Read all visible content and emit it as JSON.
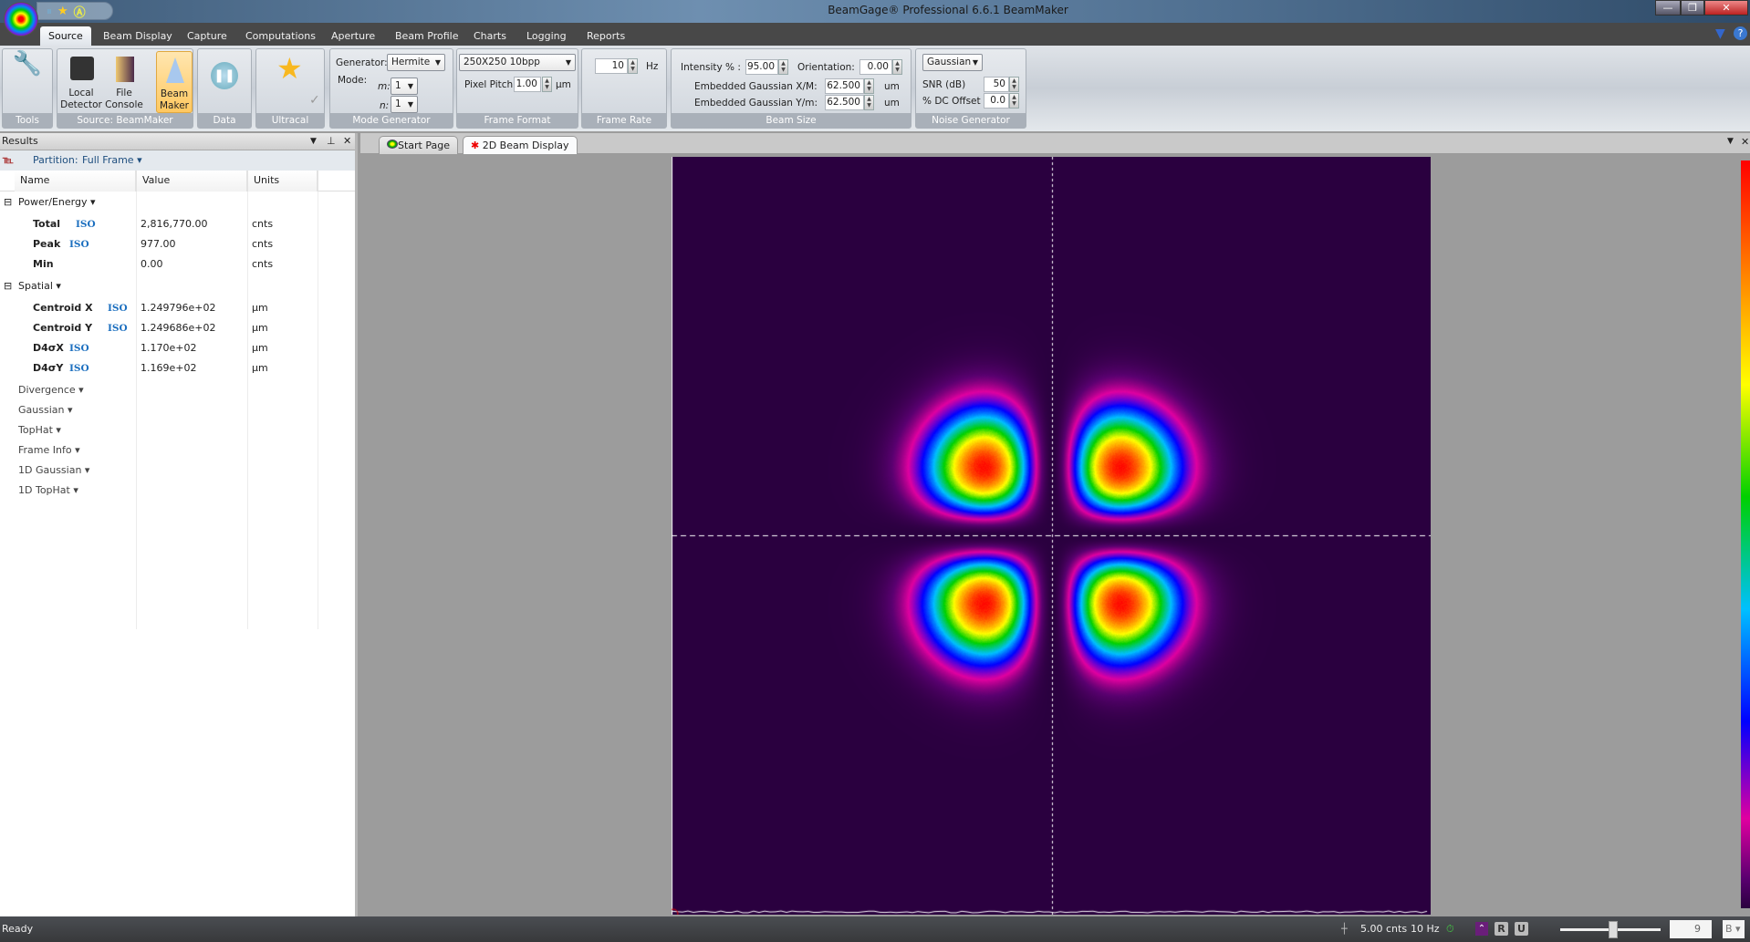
{
  "window": {
    "title": "BeamGage® Professional 6.6.1 BeamMaker"
  },
  "quick_access": [
    "pause-icon",
    "star-icon",
    "ultracal-icon"
  ],
  "menu": {
    "tabs": [
      "Source",
      "Beam Display",
      "Capture",
      "Computations",
      "Aperture",
      "Beam Profile",
      "Charts",
      "Logging",
      "Reports"
    ],
    "active": "Source"
  },
  "ribbon": {
    "tools": {
      "label": "Tools"
    },
    "source": {
      "label": "Source: BeamMaker",
      "local_detector": "Local Detector",
      "file_console": "File Console",
      "beam_maker": "Beam Maker"
    },
    "data": {
      "label": "Data"
    },
    "ultracal": {
      "label": "Ultracal"
    },
    "mode_generator": {
      "label": "Mode Generator",
      "generator_label": "Generator:",
      "generator": "Hermite",
      "mode_label": "Mode:",
      "m_label": "m:",
      "m": "1",
      "n_label": "n:",
      "n": "1"
    },
    "frame_format": {
      "label": "Frame Format",
      "format": "250X250 10bpp",
      "pixel_pitch_label": "Pixel Pitch:",
      "pixel_pitch": "1.00",
      "pixel_pitch_unit": "µm"
    },
    "frame_rate": {
      "label": "Frame Rate",
      "value": "10",
      "unit": "Hz"
    },
    "beam_size": {
      "label": "Beam Size",
      "intensity_label": "Intensity % :",
      "intensity": "95.00",
      "orientation_label": "Orientation:",
      "orientation": "0.00",
      "gx_label": "Embedded Gaussian X/M:",
      "gx": "62.500",
      "gy_label": "Embedded Gaussian Y/m:",
      "gy": "62.500",
      "unit": "um"
    },
    "noise": {
      "label": "Noise Generator",
      "type": "Gaussian",
      "snr_label": "SNR (dB)",
      "snr": "50",
      "dc_label": "% DC Offset",
      "dc": "0.0"
    }
  },
  "results": {
    "title": "Results",
    "partition_label": "Partition:",
    "partition": "Full Frame",
    "columns": [
      "Name",
      "Value",
      "Units"
    ],
    "groups": [
      {
        "name": "Power/Energy",
        "rows": [
          {
            "name": "Total",
            "iso": "ISO",
            "value": "2,816,770.00",
            "unit": "cnts"
          },
          {
            "name": "Peak",
            "iso": "ISO",
            "value": "977.00",
            "unit": "cnts"
          },
          {
            "name": "Min",
            "iso": "",
            "value": "0.00",
            "unit": "cnts"
          }
        ]
      },
      {
        "name": "Spatial",
        "rows": [
          {
            "name": "Centroid X",
            "iso": "ISO",
            "value": "1.249796e+02",
            "unit": "µm"
          },
          {
            "name": "Centroid Y",
            "iso": "ISO",
            "value": "1.249686e+02",
            "unit": "µm"
          },
          {
            "name": "D4σX",
            "iso": "ISO",
            "value": "1.170e+02",
            "unit": "µm"
          },
          {
            "name": "D4σY",
            "iso": "ISO",
            "value": "1.169e+02",
            "unit": "µm"
          }
        ]
      }
    ],
    "collapsed": [
      "Divergence",
      "Gaussian",
      "TopHat",
      "Frame Info",
      "1D Gaussian",
      "1D TopHat"
    ]
  },
  "doc_tabs": [
    {
      "label": "Start Page"
    },
    {
      "label": "2D Beam Display",
      "active": true
    }
  ],
  "beam_display": {
    "mode": "Hermite TEM11",
    "palette": [
      "#2a003f",
      "#5a0070",
      "#e000a0",
      "#0000ff",
      "#00c0ff",
      "#00d000",
      "#ffff00",
      "#ff8000",
      "#ff0000"
    ]
  },
  "status": {
    "text": "Ready",
    "cursor_value": "5.00 cnts",
    "rate": "10 Hz",
    "r_label": "R",
    "u_label": "U",
    "zoom_value": "9",
    "zoom_unit": "B"
  }
}
